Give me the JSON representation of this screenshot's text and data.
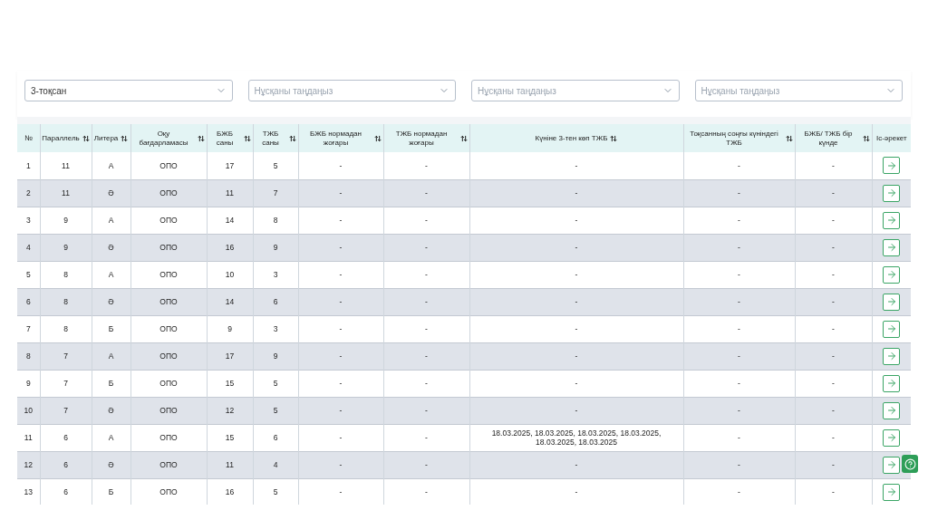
{
  "filters": [
    {
      "value": "3-тоқсан"
    },
    {
      "placeholder": "Нұсқаны таңдаңыз"
    },
    {
      "placeholder": "Нұсқаны таңдаңыз"
    },
    {
      "placeholder": "Нұсқаны таңдаңыз"
    }
  ],
  "table": {
    "columns": [
      {
        "label": "№",
        "sortable": false
      },
      {
        "label": "Параллель",
        "sortable": true
      },
      {
        "label": "Литера",
        "sortable": true
      },
      {
        "label": "Оқу бағдарламасы",
        "sortable": true
      },
      {
        "label": "БЖБ саны",
        "sortable": true
      },
      {
        "label": "ТЖБ саны",
        "sortable": true
      },
      {
        "label": "БЖБ нормадан жоғары",
        "sortable": true
      },
      {
        "label": "ТЖБ нормадан жоғары",
        "sortable": true
      },
      {
        "label": "Күніне 3-тен көп ТЖБ",
        "sortable": true
      },
      {
        "label": "Тоқсанның соңғы күніндегі ТЖБ",
        "sortable": true
      },
      {
        "label": "БЖБ/ ТЖБ бір күнде",
        "sortable": true
      },
      {
        "label": "Іс-әрекет",
        "sortable": false
      }
    ],
    "rows": [
      {
        "cells": [
          "1",
          "11",
          "А",
          "ОПО",
          "17",
          "5",
          "-",
          "-",
          "-",
          "-",
          "-"
        ]
      },
      {
        "cells": [
          "2",
          "11",
          "Ә",
          "ОПО",
          "11",
          "7",
          "-",
          "-",
          "-",
          "-",
          "-"
        ]
      },
      {
        "cells": [
          "3",
          "9",
          "А",
          "ОПО",
          "14",
          "8",
          "-",
          "-",
          "-",
          "-",
          "-"
        ]
      },
      {
        "cells": [
          "4",
          "9",
          "Ә",
          "ОПО",
          "16",
          "9",
          "-",
          "-",
          "-",
          "-",
          "-"
        ]
      },
      {
        "cells": [
          "5",
          "8",
          "А",
          "ОПО",
          "10",
          "3",
          "-",
          "-",
          "-",
          "-",
          "-"
        ]
      },
      {
        "cells": [
          "6",
          "8",
          "Ә",
          "ОПО",
          "14",
          "6",
          "-",
          "-",
          "-",
          "-",
          "-"
        ]
      },
      {
        "cells": [
          "7",
          "8",
          "Б",
          "ОПО",
          "9",
          "3",
          "-",
          "-",
          "-",
          "-",
          "-"
        ]
      },
      {
        "cells": [
          "8",
          "7",
          "А",
          "ОПО",
          "17",
          "9",
          "-",
          "-",
          "-",
          "-",
          "-"
        ]
      },
      {
        "cells": [
          "9",
          "7",
          "Б",
          "ОПО",
          "15",
          "5",
          "-",
          "-",
          "-",
          "-",
          "-"
        ]
      },
      {
        "cells": [
          "10",
          "7",
          "Ә",
          "ОПО",
          "12",
          "5",
          "-",
          "-",
          "-",
          "-",
          "-"
        ]
      },
      {
        "cells": [
          "11",
          "6",
          "А",
          "ОПО",
          "15",
          "6",
          "-",
          "-",
          "18.03.2025, 18.03.2025, 18.03.2025, 18.03.2025, 18.03.2025, 18.03.2025",
          "-",
          "-"
        ]
      },
      {
        "cells": [
          "12",
          "6",
          "Ә",
          "ОПО",
          "11",
          "4",
          "-",
          "-",
          "-",
          "-",
          "-"
        ]
      },
      {
        "cells": [
          "13",
          "6",
          "Б",
          "ОПО",
          "16",
          "5",
          "-",
          "-",
          "-",
          "-",
          "-"
        ]
      }
    ]
  }
}
